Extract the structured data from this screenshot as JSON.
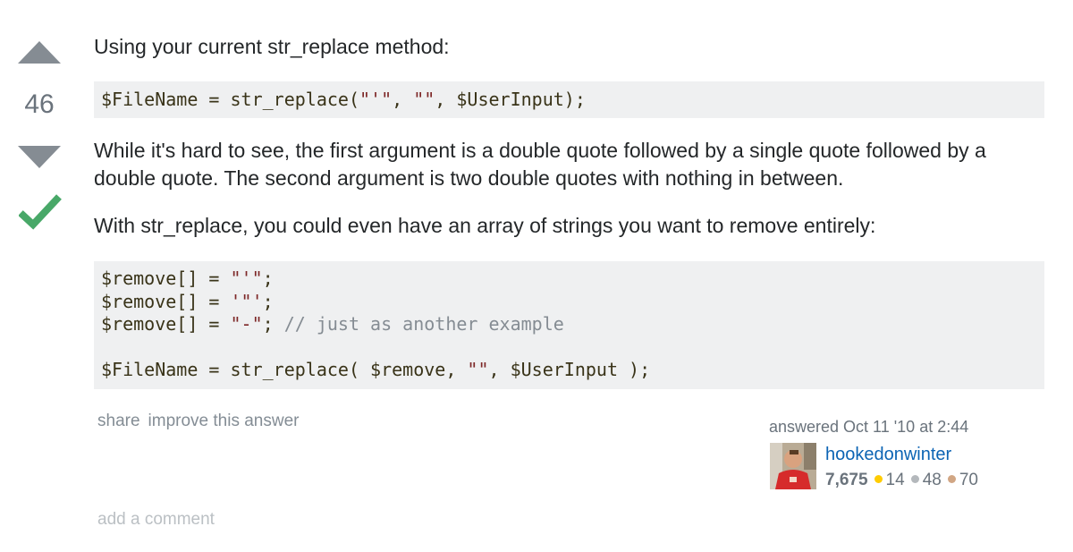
{
  "vote": {
    "count": "46",
    "accepted": true,
    "accepted_color": "#48a868",
    "arrow_color": "#858c93"
  },
  "post": {
    "paragraph_1": "Using your current str_replace method:",
    "code_1": {
      "segments": [
        {
          "text": "$FileName = str_replace(",
          "type": "plain"
        },
        {
          "text": "\"'\"",
          "type": "string"
        },
        {
          "text": ", ",
          "type": "plain"
        },
        {
          "text": "\"\"",
          "type": "string"
        },
        {
          "text": ", $UserInput);",
          "type": "plain"
        }
      ]
    },
    "paragraph_2": "While it's hard to see, the first argument is a double quote followed by a single quote followed by a double quote. The second argument is two double quotes with nothing in between.",
    "paragraph_2_lines": [
      "While it's hard to see, the first argument is a double quote followed by a single quote followed by a",
      "double quote. The second argument is two double quotes with nothing in between."
    ],
    "paragraph_3": "With str_replace, you could even have an array of strings you want to remove entirely:",
    "code_2": {
      "lines": [
        [
          {
            "text": "$remove[] = ",
            "type": "plain"
          },
          {
            "text": "\"'\"",
            "type": "string"
          },
          {
            "text": ";",
            "type": "plain"
          }
        ],
        [
          {
            "text": "$remove[] = ",
            "type": "plain"
          },
          {
            "text": "'\"'",
            "type": "string"
          },
          {
            "text": ";",
            "type": "plain"
          }
        ],
        [
          {
            "text": "$remove[] = ",
            "type": "plain"
          },
          {
            "text": "\"-\"",
            "type": "string"
          },
          {
            "text": "; ",
            "type": "plain"
          },
          {
            "text": "// just as another example",
            "type": "comment"
          }
        ],
        [],
        [
          {
            "text": "$FileName = str_replace( $remove, ",
            "type": "plain"
          },
          {
            "text": "\"\"",
            "type": "string"
          },
          {
            "text": ", $UserInput );",
            "type": "plain"
          }
        ]
      ]
    }
  },
  "menu": {
    "share": "share",
    "improve": "improve this answer"
  },
  "signature": {
    "answered": "answered Oct 11 '10 at 2:44",
    "username": "hookedonwinter",
    "reputation": "7,675",
    "gold": "14",
    "silver": "48",
    "bronze": "70",
    "gold_color": "#ffcc01",
    "silver_color": "#b4b8bc",
    "bronze_color": "#d1a684"
  },
  "add_comment": "add a comment"
}
